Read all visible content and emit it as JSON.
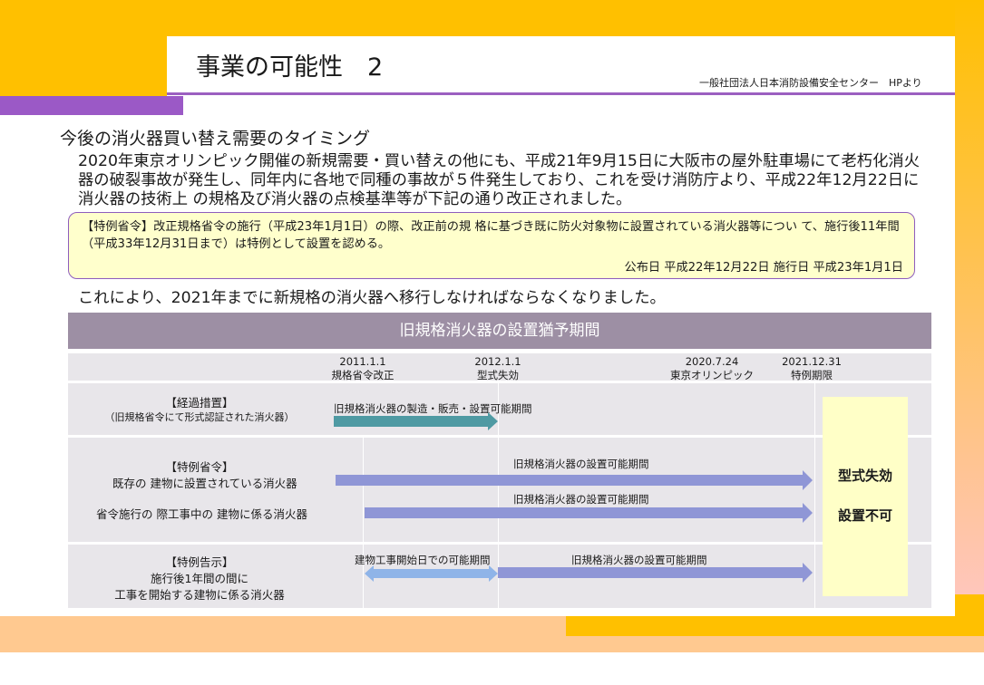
{
  "header": {
    "title": "事業の可能性　2",
    "source": "一般社団法人日本消防設備安全センター　HPより"
  },
  "content": {
    "subtitle": "今後の消火器買い替え需要のタイミング",
    "body": "2020年東京オリンピック開催の新規需要・買い替えの他にも、平成21年9月15日に大阪市の屋外駐車場にて老朽化消火 器の破裂事故が発生し、同年内に各地で同種の事故が５件発生しており、これを受け消防庁より、平成22年12月22日に消火器の技術上 の規格及び消火器の点検基準等が下記の通り改正されました。",
    "box_text": "【特例省令】改正規格省令の施行（平成23年1月1日）の際、改正前の規 格に基づき既に防火対象物に設置されている消火器等につい て、施行後11年間（平成33年12月31日まで）は特例として設置を認める。",
    "box_date": "公布日 平成22年12月22日 施行日 平成23年1月1日",
    "conclusion": "これにより、2021年までに新規格の消火器へ移行しなければならなくなりました。"
  },
  "timeline": {
    "header": "旧規格消火器の設置猶予期間",
    "milestones": [
      {
        "date": "2011.1.1",
        "label": "規格省令改正"
      },
      {
        "date": "2012.1.1",
        "label": "型式失効"
      },
      {
        "date": "2020.7.24",
        "label": "東京オリンピック"
      },
      {
        "date": "2021.12.31",
        "label": "特例期限"
      }
    ],
    "rows": {
      "transition_title": "【経過措置】",
      "transition_sub": "（旧規格省令にて形式認証された消火器）",
      "transition_bar": "旧規格消火器の製造・販売・設置可能期間",
      "special_title": "【特例省令】",
      "special_item1": "既存の 建物に設置されている消火器",
      "special_bar1": "旧規格消火器の設置可能期間",
      "special_item2": "省令施行の 際工事中の 建物に係る消火器",
      "special_bar2": "旧規格消火器の設置可能期間",
      "notice_title": "【特例告示】",
      "notice_line1": "施行後1年間の間に",
      "notice_line2": "工事を開始する建物に係る消火器",
      "notice_bar1": "建物工事開始日での可能期間",
      "notice_bar2": "旧規格消火器の設置可能期間"
    },
    "result": {
      "line1": "型式失効",
      "line2": "設置不可"
    },
    "colors": {
      "teal": "#4f9aa3",
      "purple": "#8f96d6",
      "light_blue": "#8fb4e8",
      "result_bg": "#ffffc7"
    }
  }
}
